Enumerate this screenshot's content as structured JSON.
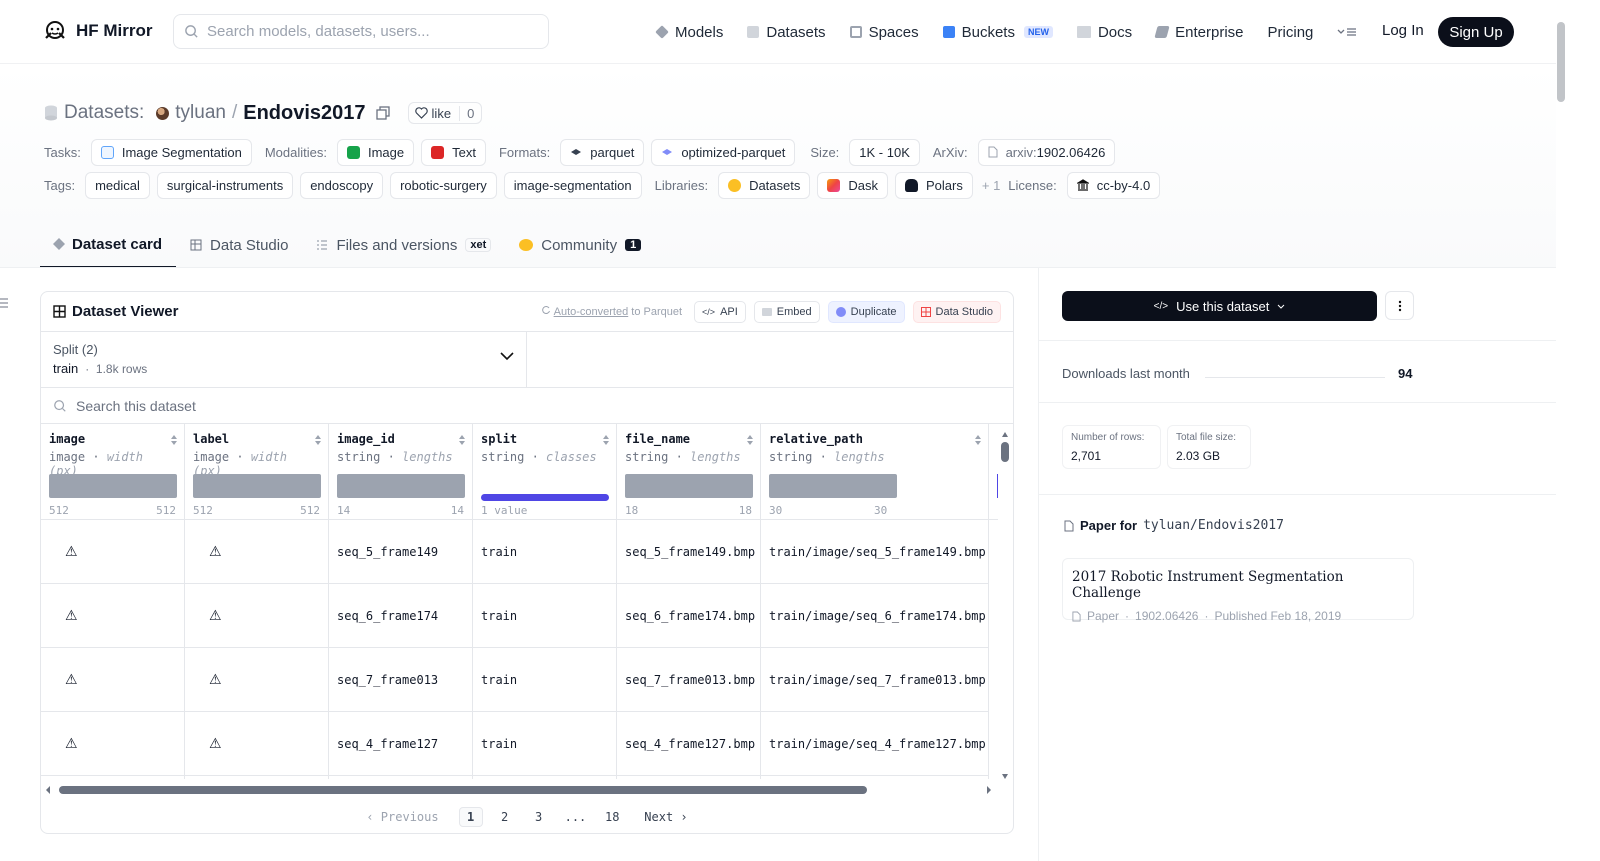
{
  "nav": {
    "brand": "HF Mirror",
    "search_placeholder": "Search models, datasets, users...",
    "links": [
      "Models",
      "Datasets",
      "Spaces",
      "Buckets",
      "Docs",
      "Enterprise",
      "Pricing"
    ],
    "buckets_badge": "NEW",
    "login": "Log In",
    "signup": "Sign Up"
  },
  "header": {
    "crumb_label": "Datasets:",
    "owner": "tyluan",
    "slash": "/",
    "name": "Endovis2017",
    "like_label": "like",
    "like_count": "0",
    "tasks_label": "Tasks:",
    "task": "Image Segmentation",
    "modalities_label": "Modalities:",
    "modality_image": "Image",
    "modality_text": "Text",
    "formats_label": "Formats:",
    "format_parquet": "parquet",
    "format_optimized": "optimized-parquet",
    "size_label": "Size:",
    "size": "1K - 10K",
    "arxiv_label": "ArXiv:",
    "arxiv_prefix": "arxiv:",
    "arxiv": "1902.06426",
    "tags_label": "Tags:",
    "tags": [
      "medical",
      "surgical-instruments",
      "endoscopy",
      "robotic-surgery",
      "image-segmentation"
    ],
    "libraries_label": "Libraries:",
    "libraries": [
      "Datasets",
      "Dask",
      "Polars"
    ],
    "libraries_more": "+ 1",
    "license_label": "License:",
    "license": "cc-by-4.0"
  },
  "tabs": {
    "card": "Dataset card",
    "studio": "Data Studio",
    "files": "Files and versions",
    "xet": "xet",
    "community": "Community",
    "community_count": "1"
  },
  "viewer": {
    "title": "Dataset Viewer",
    "autoconv_link": "Auto-converted",
    "autoconv_rest": "to Parquet",
    "api": "API",
    "embed": "Embed",
    "duplicate": "Duplicate",
    "data_studio": "Data Studio",
    "split_title": "Split (2)",
    "split_value": "train",
    "split_rows": "1.8k rows",
    "search_placeholder": "Search this dataset",
    "columns": [
      {
        "name": "image",
        "type": "image",
        "stat": "width (px)",
        "min": "512",
        "max": "512"
      },
      {
        "name": "label",
        "type": "image",
        "stat": "width (px)",
        "min": "512",
        "max": "512"
      },
      {
        "name": "image_id",
        "type": "string",
        "stat": "lengths",
        "min": "14",
        "max": "14"
      },
      {
        "name": "split",
        "type": "string",
        "stat": "classes",
        "min": "1 value",
        "max": ""
      },
      {
        "name": "file_name",
        "type": "string",
        "stat": "lengths",
        "min": "18",
        "max": "18"
      },
      {
        "name": "relative_path",
        "type": "string",
        "stat": "lengths",
        "min": "30",
        "max": "30"
      }
    ],
    "rows": [
      {
        "image_id": "seq_5_frame149",
        "split": "train",
        "file_name": "seq_5_frame149.bmp",
        "relative_path": "train/image/seq_5_frame149.bmp"
      },
      {
        "image_id": "seq_6_frame174",
        "split": "train",
        "file_name": "seq_6_frame174.bmp",
        "relative_path": "train/image/seq_6_frame174.bmp"
      },
      {
        "image_id": "seq_7_frame013",
        "split": "train",
        "file_name": "seq_7_frame013.bmp",
        "relative_path": "train/image/seq_7_frame013.bmp"
      },
      {
        "image_id": "seq_4_frame127",
        "split": "train",
        "file_name": "seq_4_frame127.bmp",
        "relative_path": "train/image/seq_4_frame127.bmp"
      }
    ],
    "pager": {
      "prev": "Previous",
      "pages": [
        "1",
        "2",
        "3",
        "...",
        "18"
      ],
      "next": "Next"
    }
  },
  "sidebar": {
    "use_button": "Use this dataset",
    "downloads_label": "Downloads last month",
    "downloads": "94",
    "rows_label": "Number of rows:",
    "rows": "2,701",
    "filesize_label": "Total file size:",
    "filesize": "2.03 GB",
    "paper_for": "Paper for",
    "paper_repo": "tyluan/Endovis2017",
    "paper_title": "2017 Robotic Instrument Segmentation Challenge",
    "paper_label": "Paper",
    "paper_id": "1902.06426",
    "paper_published": "Published Feb 18, 2019"
  }
}
